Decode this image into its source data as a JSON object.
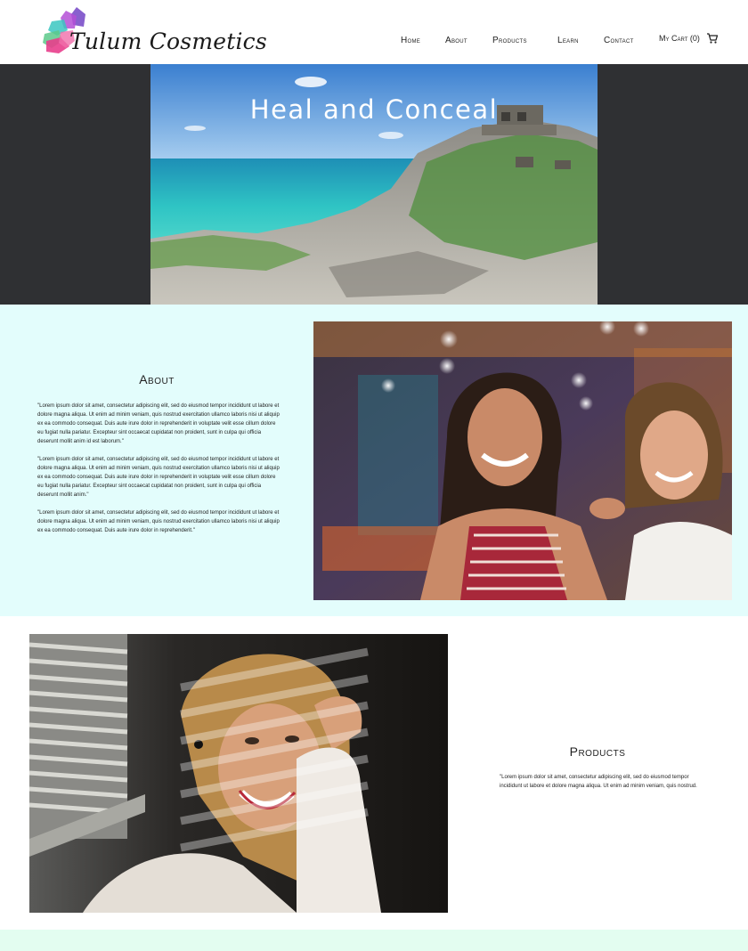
{
  "brand": {
    "name": "Tulum Cosmetics",
    "colors": {
      "pink": "#e83e8c",
      "purple": "#7b4fc9",
      "teal": "#3ac7c1",
      "green": "#5cc98a"
    }
  },
  "nav": {
    "items": [
      "Home",
      "About",
      "Products",
      "Learn",
      "Contact"
    ],
    "cart_label": "My Cart (0)",
    "cart_icon": "shopping-cart-icon"
  },
  "hero": {
    "title": "Heal and Conceal",
    "background": "#2f3033"
  },
  "about": {
    "heading": "About",
    "paragraphs": [
      "\"Lorem ipsum dolor sit amet, consectetur adipiscing elit, sed do eiusmod tempor incididunt ut labore et dolore magna aliqua. Ut enim ad minim veniam, quis nostrud exercitation ullamco laboris nisi ut aliquip ex ea commodo consequat. Duis aute irure dolor in reprehenderit in voluptate velit esse cillum dolore eu fugiat nulla pariatur. Excepteur sint occaecat cupidatat non proident, sunt in culpa qui officia deserunt mollit anim id est laborum.\"",
      "\"Lorem ipsum dolor sit amet, consectetur adipiscing elit, sed do eiusmod tempor incididunt ut labore et dolore magna aliqua. Ut enim ad minim veniam, quis nostrud exercitation ullamco laboris nisi ut aliquip ex ea commodo consequat. Duis aute irure dolor in reprehenderit in voluptate velit esse cillum dolore eu fugiat nulla pariatur. Excepteur sint occaecat cupidatat non proident, sunt in culpa qui officia deserunt mollit anim.\"",
      "\"Lorem ipsum dolor sit amet, consectetur adipiscing elit, sed do eiusmod tempor incididunt ut labore et dolore magna aliqua. Ut enim ad minim veniam, quis nostrud exercitation ullamco laboris nisi ut aliquip ex ea commodo consequat. Duis aute irure dolor in reprehenderit.\""
    ],
    "background": "#e3fdfc"
  },
  "products": {
    "heading": "Products",
    "paragraphs": [
      "\"Lorem ipsum dolor sit amet, consectetur adipiscing elit, sed do eiusmod tempor incididunt ut labore et dolore magna aliqua. Ut enim ad minim veniam, quis nostrud."
    ]
  }
}
